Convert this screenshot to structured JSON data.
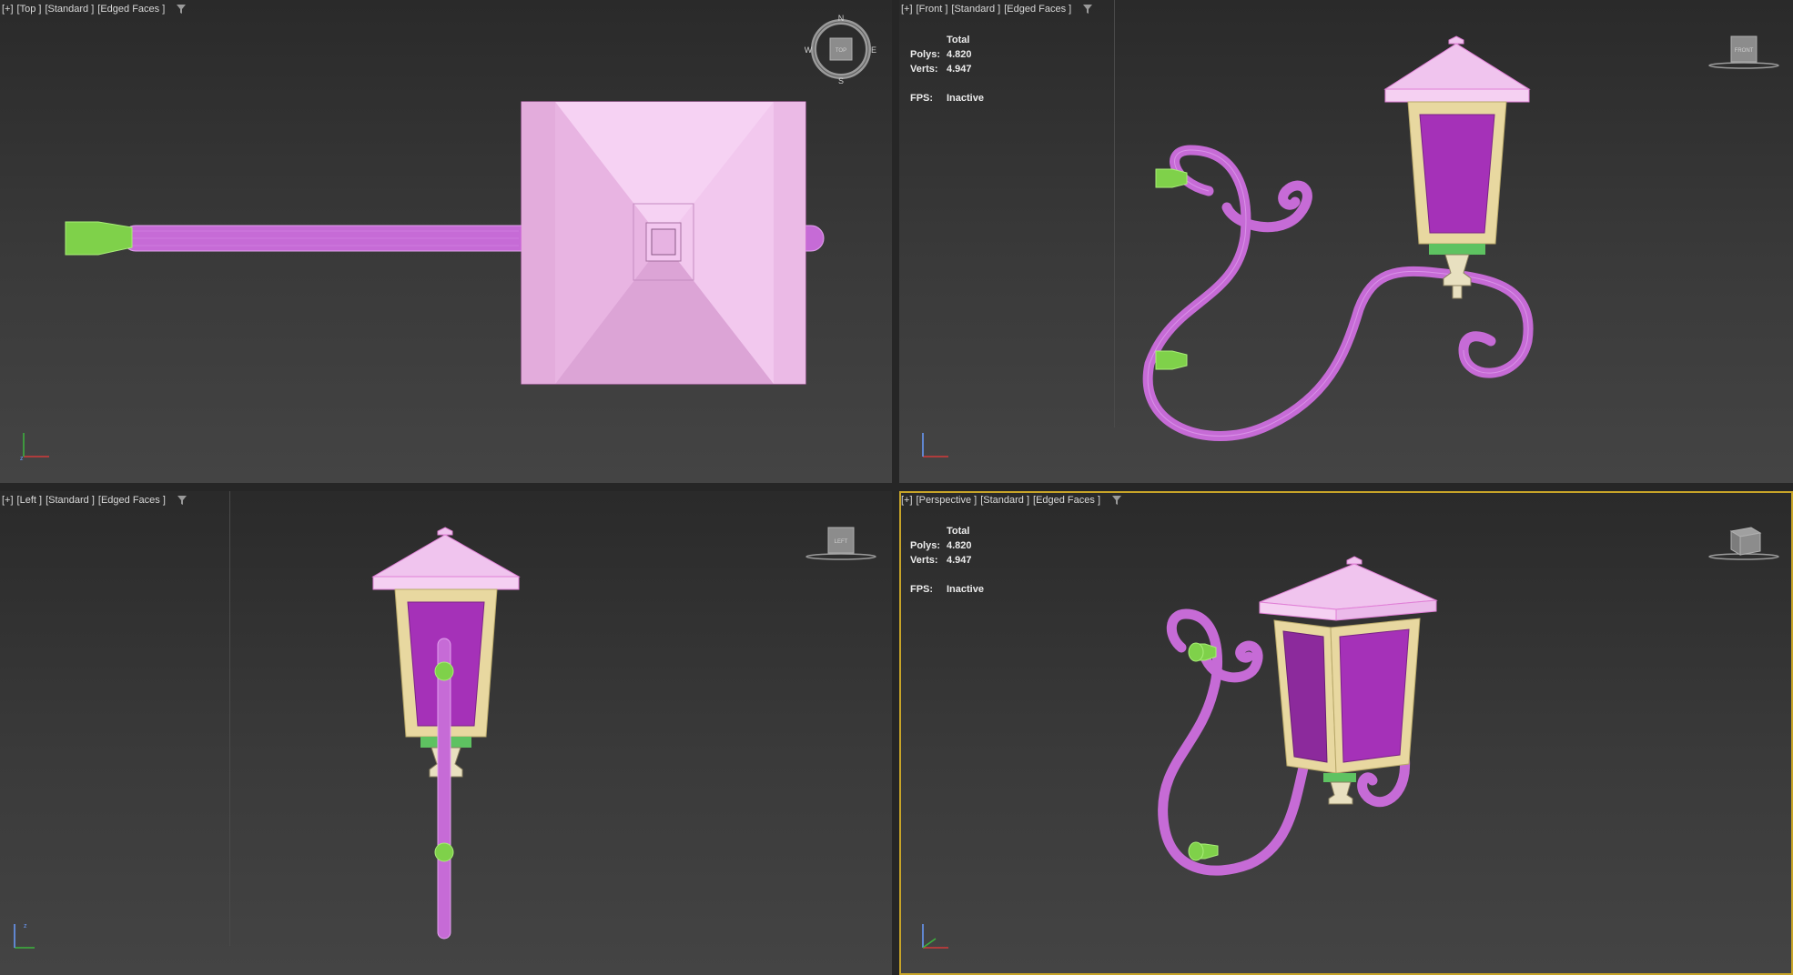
{
  "viewports": {
    "top": {
      "label": {
        "plus": "[+]",
        "view": "[Top ]",
        "shading": "[Standard ]",
        "mode": "[Edged Faces ]"
      },
      "viewcube": {
        "face": "TOP",
        "n": "N",
        "s": "S",
        "e": "E",
        "w": "W"
      }
    },
    "front": {
      "label": {
        "plus": "[+]",
        "view": "[Front ]",
        "shading": "[Standard ]",
        "mode": "[Edged Faces ]"
      },
      "stats": {
        "header": "Total",
        "polys_label": "Polys:",
        "polys": "4.820",
        "verts_label": "Verts:",
        "verts": "4.947",
        "fps_label": "FPS:",
        "fps": "Inactive"
      },
      "viewcube": {
        "face": "FRONT"
      }
    },
    "left": {
      "label": {
        "plus": "[+]",
        "view": "[Left ]",
        "shading": "[Standard ]",
        "mode": "[Edged Faces ]"
      },
      "viewcube": {
        "face": "LEFT"
      }
    },
    "perspective": {
      "label": {
        "plus": "[+]",
        "view": "[Perspective ]",
        "shading": "[Standard ]",
        "mode": "[Edged Faces ]"
      },
      "stats": {
        "header": "Total",
        "polys_label": "Polys:",
        "polys": "4.820",
        "verts_label": "Verts:",
        "verts": "4.947",
        "fps_label": "FPS:",
        "fps": "Inactive"
      },
      "viewcube": {
        "face": ""
      }
    }
  },
  "colors": {
    "roof": "#f0c4ee",
    "glass": "#a531b8",
    "frame": "#e8d8a0",
    "arm": "#c66bd6",
    "mount": "#7fd14a",
    "active_border": "#c7a428"
  },
  "icons": [
    "filter-icon",
    "axis-tripod-icon",
    "viewcube-icon",
    "compass-ring-icon"
  ]
}
